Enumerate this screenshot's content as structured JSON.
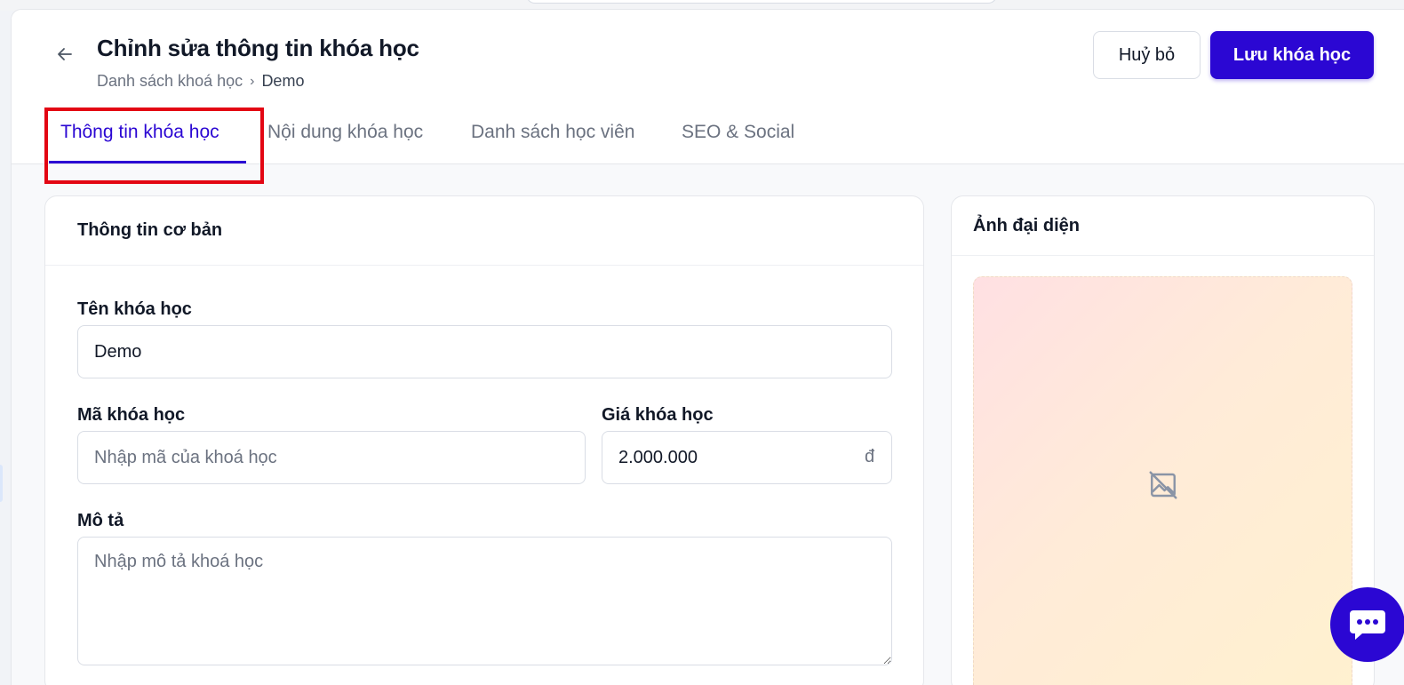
{
  "header": {
    "title": "Chỉnh sửa thông tin khóa học",
    "breadcrumb": {
      "parent": "Danh sách khoá học",
      "separator": "›",
      "current": "Demo"
    },
    "cancel_label": "Huỷ bỏ",
    "save_label": "Lưu khóa học"
  },
  "tabs": [
    {
      "label": "Thông tin khóa học",
      "active": true
    },
    {
      "label": "Nội dung khóa học",
      "active": false
    },
    {
      "label": "Danh sách học viên",
      "active": false
    },
    {
      "label": "SEO & Social",
      "active": false
    }
  ],
  "basic_info": {
    "title": "Thông tin cơ bản",
    "name_label": "Tên khóa học",
    "name_value": "Demo",
    "code_label": "Mã khóa học",
    "code_placeholder": "Nhập mã của khoá học",
    "price_label": "Giá khóa học",
    "price_value": "2.000.000",
    "price_currency": "đ",
    "description_label": "Mô tả",
    "description_placeholder": "Nhập mô tả khoá học"
  },
  "image_panel": {
    "title": "Ảnh đại diện",
    "placeholder_icon": "image-off-icon"
  },
  "icons": {
    "back": "arrow-left-icon",
    "chat": "chat-bubble-icon"
  },
  "colors": {
    "primary": "#2b07d3",
    "highlight": "#e30613",
    "muted_text": "#6b7280"
  }
}
